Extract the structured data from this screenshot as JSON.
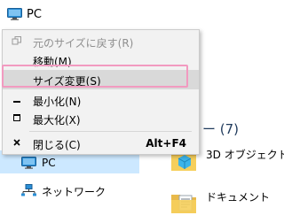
{
  "window": {
    "title": "PC"
  },
  "menu": {
    "items": [
      {
        "label": "元のサイズに戻す(R)",
        "disabled": true
      },
      {
        "label": "移動(M)",
        "disabled": false
      },
      {
        "label": "サイズ変更(S)",
        "disabled": false,
        "hovered": true
      },
      {
        "label": "最小化(N)",
        "disabled": false
      },
      {
        "label": "最大化(X)",
        "disabled": false
      },
      {
        "label": "閉じる(C)",
        "accelerator": "Alt+F4",
        "disabled": false
      }
    ]
  },
  "explorer": {
    "section_header": "ー (7)",
    "folders": [
      {
        "label": "3D オブジェクト"
      },
      {
        "label": "ドキュメント"
      }
    ],
    "nav": [
      {
        "label": "PC",
        "selected": true
      },
      {
        "label": "ネットワーク",
        "selected": false
      }
    ]
  },
  "colors": {
    "menu_bg": "#f2f2f2",
    "menu_hover": "#d9d9d9",
    "highlight_border": "#f29ac0",
    "nav_selected": "#cce8ff",
    "section_text": "#1e395b"
  }
}
